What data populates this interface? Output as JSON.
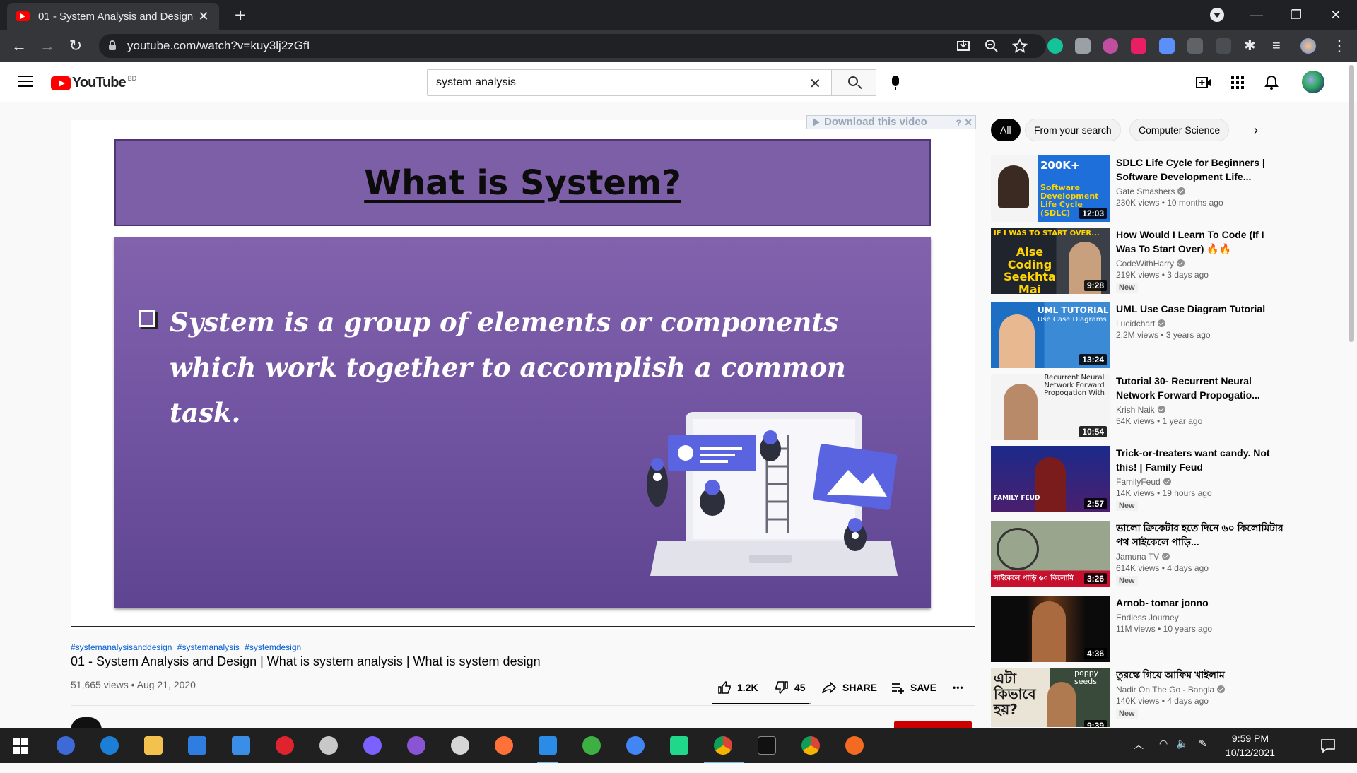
{
  "browser": {
    "tab_title": "01 - System Analysis and Design",
    "url": "youtube.com/watch?v=kuy3lj2zGfI"
  },
  "youtube": {
    "logo_text": "YouTube",
    "country_code": "BD",
    "search_value": "system analysis"
  },
  "video": {
    "download_label": "Download this video",
    "download_help": "?",
    "slide_title": "What is System?",
    "slide_text": "System is a group of elements or components which work together to accomplish a common task.",
    "hashtags": [
      "#systemanalysisanddesign",
      "#systemanalysis",
      "#systemdesign"
    ],
    "title": "01 - System Analysis and Design | What is system analysis | What is system design",
    "views_date": "51,665 views • Aug 21, 2020",
    "likes": "1.2K",
    "dislikes": "45",
    "share_label": "SHARE",
    "save_label": "SAVE",
    "more_label": "•••"
  },
  "sidebar": {
    "chips": [
      "All",
      "From your search",
      "Computer Science"
    ],
    "recommendations": [
      {
        "title": "SDLC Life Cycle for Beginners | Software Development Life...",
        "channel": "Gate Smashers",
        "verified": true,
        "meta": "230K views • 10 months ago",
        "duration": "12:03",
        "badge": "",
        "thumb_text": "Software Development Life Cycle (SDLC)",
        "thumb_text2": "200K+"
      },
      {
        "title": "How Would I Learn To Code (If I Was To Start Over) 🔥🔥",
        "channel": "CodeWithHarry",
        "verified": true,
        "meta": "219K views • 3 days ago",
        "duration": "9:28",
        "badge": "New",
        "thumb_text": "Aise Coding Seekhta Mai",
        "thumb_text2": "IF I WAS TO START OVER..."
      },
      {
        "title": "UML Use Case Diagram Tutorial",
        "channel": "Lucidchart",
        "verified": true,
        "meta": "2.2M views • 3 years ago",
        "duration": "13:24",
        "badge": "",
        "thumb_text": "UML TUTORIAL",
        "thumb_text2": "Use Case Diagrams"
      },
      {
        "title": "Tutorial 30- Recurrent Neural Network Forward Propogatio...",
        "channel": "Krish Naik",
        "verified": true,
        "meta": "54K views • 1 year ago",
        "duration": "10:54",
        "badge": "",
        "thumb_text": "Recurrent Neural Network Forward Propogation With",
        "thumb_text2": ""
      },
      {
        "title": "Trick-or-treaters want candy. Not this! | Family Feud",
        "channel": "FamilyFeud",
        "verified": true,
        "meta": "14K views • 19 hours ago",
        "duration": "2:57",
        "badge": "New",
        "thumb_text": "FAMILY FEUD",
        "thumb_text2": ""
      },
      {
        "title": "ভালো ক্রিকেটার হতে দিনে ৬০ কিলোমিটার পথ সাইকেলে পাড়ি...",
        "channel": "Jamuna TV",
        "verified": true,
        "meta": "614K views • 4 days ago",
        "duration": "3:26",
        "badge": "New",
        "thumb_text": "সাইকেলে পাড়ি ৬০ কিলোমি",
        "thumb_text2": ""
      },
      {
        "title": "Arnob- tomar jonno",
        "channel": "Endless Journey",
        "verified": false,
        "meta": "11M views • 10 years ago",
        "duration": "4:36",
        "badge": "",
        "thumb_text": "",
        "thumb_text2": ""
      },
      {
        "title": "তুরস্কে গিয়ে আফিম খাইলাম",
        "channel": "Nadir On The Go - Bangla",
        "verified": true,
        "meta": "140K views • 4 days ago",
        "duration": "9:39",
        "badge": "New",
        "thumb_text": "এটা কিভাবে হয়?",
        "thumb_text2": "poppy seeds"
      }
    ]
  },
  "taskbar": {
    "time": "9:59 PM",
    "date": "10/12/2021"
  },
  "colors": {
    "yt_red": "#ff0000",
    "slide_purple": "#7d5fa7",
    "chrome_dark": "#202124",
    "link_blue": "#065fd4"
  }
}
